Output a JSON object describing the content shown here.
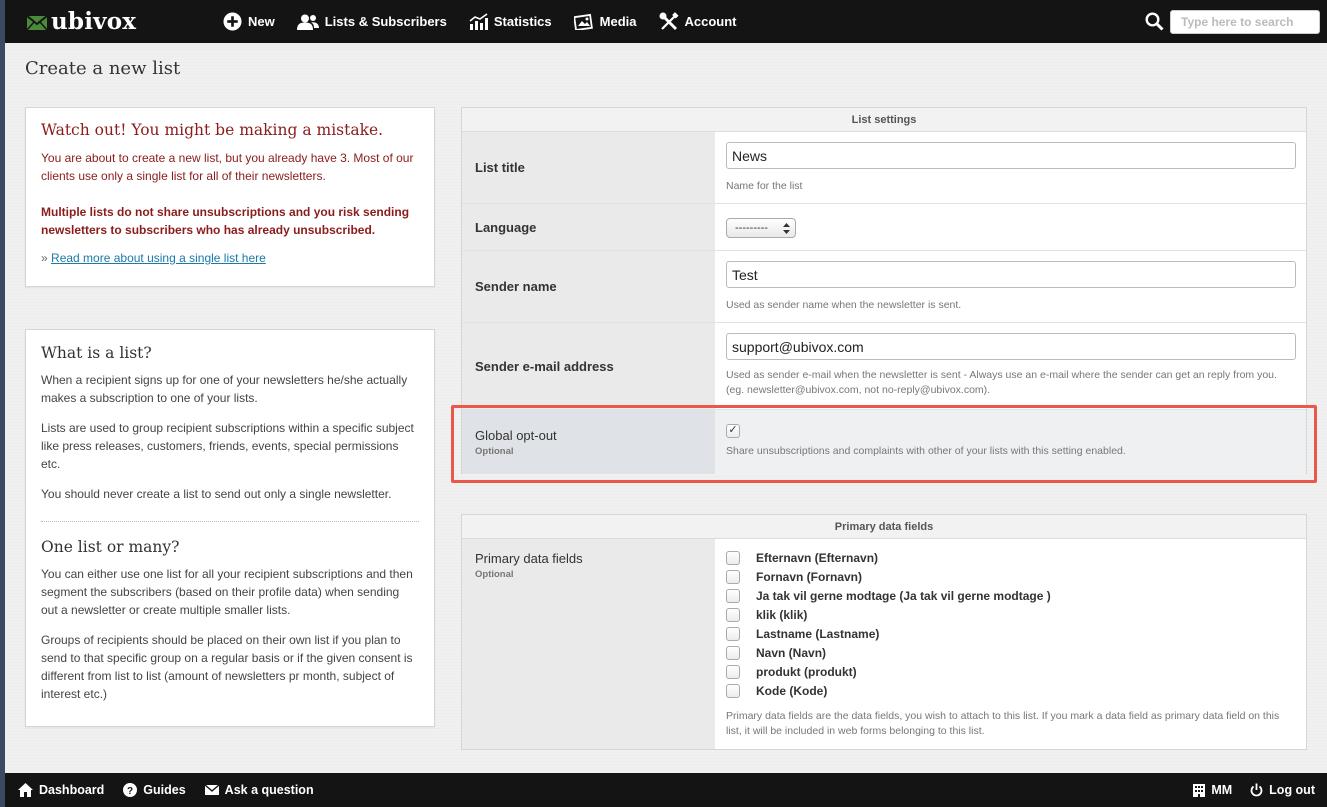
{
  "app": {
    "brand": "ubivox",
    "accent_color": "#8b1c1c",
    "link_color": "#1a7aa8",
    "highlight_color": "#e8594a"
  },
  "nav": {
    "items": [
      {
        "label": "New",
        "icon": "plus-circle-icon"
      },
      {
        "label": "Lists & Subscribers",
        "icon": "users-icon"
      },
      {
        "label": "Statistics",
        "icon": "chart-icon"
      },
      {
        "label": "Media",
        "icon": "media-icon"
      },
      {
        "label": "Account",
        "icon": "tools-icon"
      }
    ],
    "search_placeholder": "Type here to search"
  },
  "page": {
    "title": "Create a new list"
  },
  "warning": {
    "title": "Watch out! You might be making a mistake.",
    "text": "You are about to create a new list, but you already have 3. Most of our clients use only a single list for all of their newsletters.",
    "bold_text": "Multiple lists do not share unsubscriptions and you risk sending newsletters to subscribers who has already unsubscribed.",
    "link_prefix": "»",
    "link_text": "Read more about using a single list here"
  },
  "info": {
    "section1_title": "What is a list?",
    "section1_p1": "When a recipient signs up for one of your newsletters he/she actually makes a subscription to one of your lists.",
    "section1_p2": "Lists are used to group recipient subscriptions within a specific subject like press releases, customers, friends, events, special permissions etc.",
    "section1_p3": "You should never create a list to send out only a single newsletter.",
    "section2_title": "One list or many?",
    "section2_p1": "You can either use one list for all your recipient subscriptions and then segment the subscribers (based on their profile data) when sending out a newsletter or create multiple smaller lists.",
    "section2_p2": "Groups of recipients should be placed on their own list if you plan to send to that specific group on a regular basis or if the given consent is different from list to list (amount of newsletters pr month, subject of interest etc.)"
  },
  "list_settings": {
    "header": "List settings",
    "title_label": "List title",
    "title_value": "News",
    "title_help": "Name for the list",
    "language_label": "Language",
    "language_value": "---------",
    "sender_name_label": "Sender name",
    "sender_name_value": "Test",
    "sender_name_help": "Used as sender name when the newsletter is sent.",
    "sender_email_label": "Sender e-mail address",
    "sender_email_value": "support@ubivox.com",
    "sender_email_help": "Used as sender e-mail when the newsletter is sent - Always use an e-mail where the sender can get an reply from you. (eg. newsletter@ubivox.com, not no-reply@ubivox.com).",
    "optout_label": "Global opt-out",
    "optout_optional": "Optional",
    "optout_checked": "✓",
    "optout_help": "Share unsubscriptions and complaints with other of your lists with this setting enabled."
  },
  "primary_fields": {
    "header": "Primary data fields",
    "label": "Primary data fields",
    "optional": "Optional",
    "items": [
      "Efternavn (Efternavn)",
      "Fornavn (Fornavn)",
      "Ja tak vil gerne modtage (Ja tak vil gerne modtage )",
      "klik (klik)",
      "Lastname (Lastname)",
      "Navn (Navn)",
      "produkt (produkt)",
      "Kode (Kode)"
    ],
    "help": "Primary data fields are the data fields, you wish to attach to this list. If you mark a data field as primary data field on this list, it will be included in web forms belonging to this list."
  },
  "footer": {
    "dashboard": "Dashboard",
    "guides": "Guides",
    "ask": "Ask a question",
    "user": "MM",
    "logout": "Log out"
  }
}
